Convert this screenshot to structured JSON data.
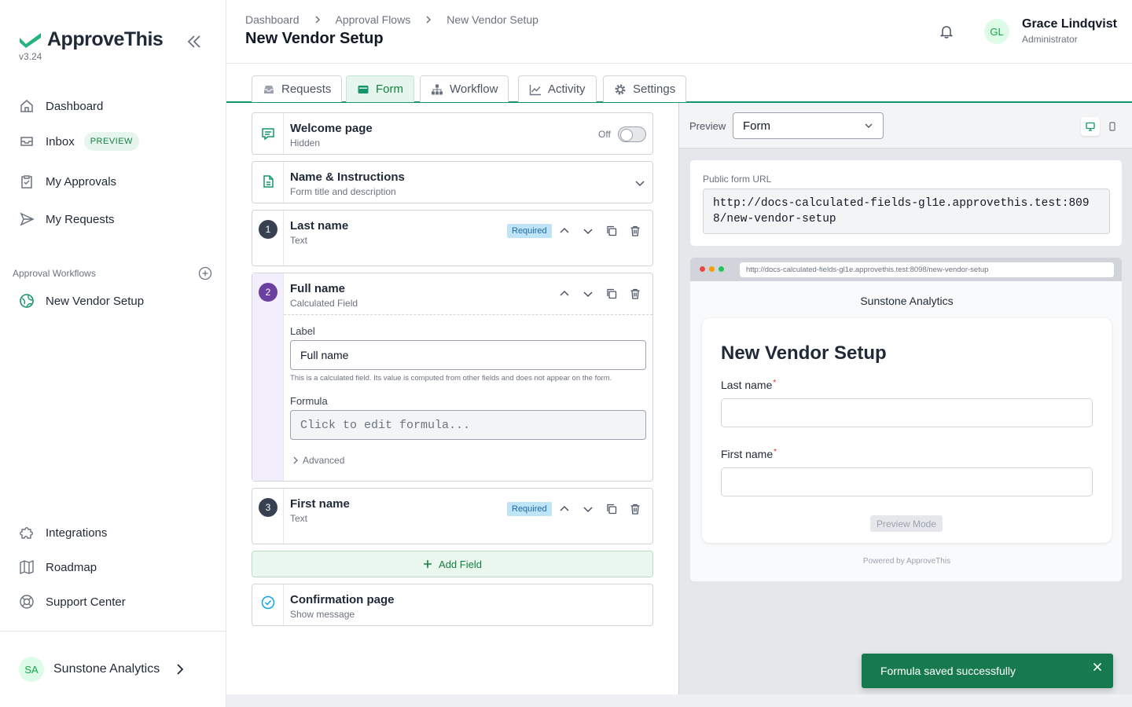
{
  "brand": {
    "name": "ApproveThis",
    "version": "v3.24"
  },
  "sidebar": {
    "items": [
      {
        "label": "Dashboard"
      },
      {
        "label": "Inbox",
        "badge": "PREVIEW"
      },
      {
        "label": "My Approvals"
      },
      {
        "label": "My Requests"
      }
    ],
    "section_label": "Approval Workflows",
    "workflows": [
      {
        "label": "New Vendor Setup"
      }
    ],
    "bottom_items": [
      {
        "label": "Integrations"
      },
      {
        "label": "Roadmap"
      },
      {
        "label": "Support Center"
      }
    ],
    "org": {
      "initials": "SA",
      "name": "Sunstone Analytics"
    }
  },
  "header": {
    "breadcrumbs": [
      "Dashboard",
      "Approval Flows",
      "New Vendor Setup"
    ],
    "title": "New Vendor Setup",
    "user": {
      "initials": "GL",
      "name": "Grace Lindqvist",
      "role": "Administrator"
    }
  },
  "tabs": [
    {
      "label": "Requests"
    },
    {
      "label": "Form",
      "active": true
    },
    {
      "label": "Workflow"
    },
    {
      "label": "Activity"
    },
    {
      "label": "Settings"
    }
  ],
  "builder": {
    "welcome": {
      "title": "Welcome page",
      "subtitle": "Hidden",
      "toggle_label": "Off",
      "enabled": false
    },
    "name_instructions": {
      "title": "Name & Instructions",
      "subtitle": "Form title and description"
    },
    "fields": [
      {
        "number": "1",
        "title": "Last name",
        "type": "Text",
        "badge": "Required"
      },
      {
        "number": "2",
        "title": "Full name",
        "type": "Calculated Field",
        "label_caption": "Label",
        "label_value": "Full name",
        "help": "This is a calculated field. Its value is computed from other fields and does not appear on the form.",
        "formula_caption": "Formula",
        "formula_placeholder": "Click to edit formula...",
        "advanced": "Advanced"
      },
      {
        "number": "3",
        "title": "First name",
        "type": "Text",
        "badge": "Required"
      }
    ],
    "add_field": "Add Field",
    "confirmation": {
      "title": "Confirmation page",
      "subtitle": "Show message"
    }
  },
  "preview": {
    "label": "Preview",
    "select_value": "Form",
    "url_label": "Public form URL",
    "url": "http://docs-calculated-fields-gl1e.approvethis.test:8098/new-vendor-setup",
    "browser_url": "http://docs-calculated-fields-gl1e.approvethis.test:8098/new-vendor-setup",
    "org_name": "Sunstone Analytics",
    "form_title": "New Vendor Setup",
    "form_fields": [
      "Last name",
      "First name"
    ],
    "required_marker": "*",
    "mode_button": "Preview Mode",
    "powered_by": "Powered by ApproveThis"
  },
  "toast": {
    "message": "Formula saved successfully"
  },
  "colors": {
    "accent": "#15956b",
    "toast": "#177a4f",
    "calc_field": "#6b3fa0",
    "required_badge": "#bfe3f7"
  }
}
